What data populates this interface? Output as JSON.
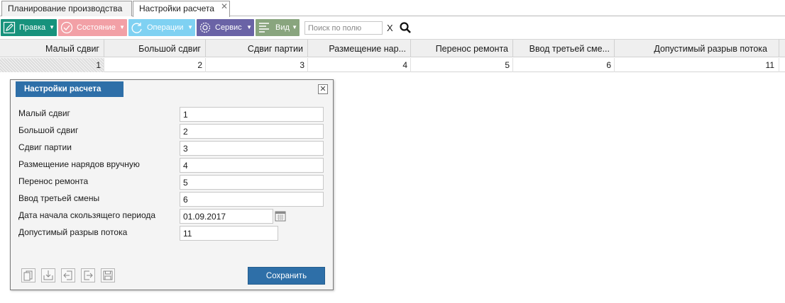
{
  "tabs": [
    {
      "label": "Планирование производства"
    },
    {
      "label": "Настройки расчета",
      "close": "✕"
    }
  ],
  "toolbar": {
    "edit_label": "Правка",
    "state_label": "Состояние",
    "operations_label": "Операции",
    "service_label": "Сервис",
    "view_label": "Вид",
    "search_placeholder": "Поиск по полю",
    "clear_label": "X",
    "colors": {
      "edit": "#17927c",
      "state": "#f2a0a6",
      "operations": "#7fd1f2",
      "service": "#6a63a6",
      "view": "#89a57e"
    }
  },
  "grid": {
    "columns": [
      "Малый сдвиг",
      "Большой сдвиг",
      "Сдвиг партии",
      "Размещение нар...",
      "Перенос ремонта",
      "Ввод третьей сме...",
      "Допустимый разрыв потока"
    ],
    "row": [
      "1",
      "2",
      "3",
      "4",
      "5",
      "6",
      "11"
    ]
  },
  "dialog": {
    "title": "Настройки расчета",
    "close": "✕",
    "fields": [
      {
        "label": "Малый сдвиг",
        "value": "1"
      },
      {
        "label": "Большой сдвиг",
        "value": "2"
      },
      {
        "label": "Сдвиг партии",
        "value": "3"
      },
      {
        "label": "Размещение нарядов вручную",
        "value": "4"
      },
      {
        "label": "Перенос ремонта",
        "value": "5"
      },
      {
        "label": "Ввод третьей смены",
        "value": "6"
      },
      {
        "label": "Дата начала скользящего периода",
        "value": "01.09.2017"
      },
      {
        "label": "Допустимый разрыв потока",
        "value": "11"
      }
    ],
    "save_label": "Сохранить",
    "accent": "#2e6fa8"
  }
}
